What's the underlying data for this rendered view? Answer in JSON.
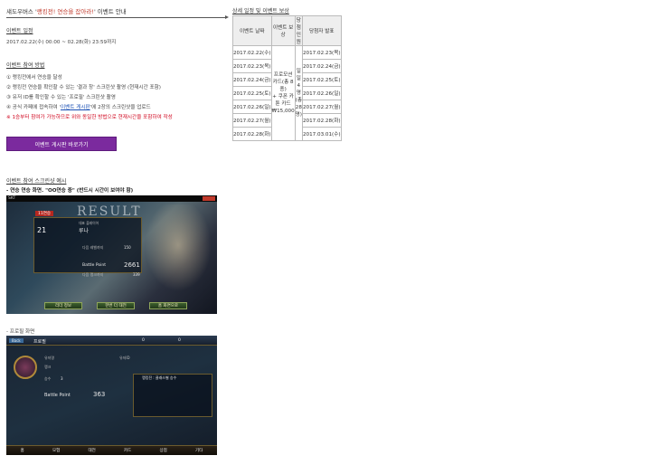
{
  "header": {
    "title_prefix": "섀도우버스 '",
    "title_highlight": "랭킹전! 연승을 잡아라!",
    "title_suffix": "' 이벤트 안내"
  },
  "schedule": {
    "heading": "이벤트 일정",
    "period": "2017.02.22(수) 00:00 ~ 02.28(화) 23:59까지"
  },
  "method": {
    "heading": "이벤트 참여 방법",
    "steps": [
      "① 랭킹전에서 연승을 달성",
      "② 랭킹전 연승을 확인할 수 있는 '결과 창' 스크린샷 촬영 (현재시간 포함)",
      "③ 유저 ID를 확인할 수 있는 '프로필' 스크린샷 촬영"
    ],
    "step4_prefix": "④ 공식 카페에 접속하여 '",
    "step4_link": "이벤트 게시판",
    "step4_suffix": "'에 2장의 스크린샷을 업로드",
    "warning": "※ 1승부터 참여가 가능하므로 위와 동일한 방법으로 현재시간을 포함하여 작성"
  },
  "cta": {
    "label": "이벤트 게시판 바로가기"
  },
  "examples": {
    "heading": "이벤트 참여 스크린샷 예시",
    "example1_caption": "- 연승 연승 화면. \"OO연승 중\" (반드시 시간이 보여야 함)",
    "example2_caption": "- 프로필 화면"
  },
  "game1": {
    "carrier": "SKT",
    "banner": "RESULT",
    "wins_badge": "11연승",
    "rank_num": "21",
    "rank_label": "대표 플레이어",
    "player": "루나",
    "next_label": "다음 레벨까지",
    "next_value": "150",
    "bp_label": "Battle Point",
    "bp_value": "2661",
    "next2_label": "다음 랭크까지",
    "next2_value": "339",
    "btn_1": "리더 정보",
    "btn_2": "한번 더 대전",
    "btn_3": "홈 화면으로"
  },
  "game2": {
    "back": "Back",
    "title": "프로필",
    "level_label": "유저명",
    "rank_label": "랭크",
    "win_label": "승수",
    "win_value": "3",
    "bp_label": "Battle Point",
    "bp_value": "363",
    "id_label": "유저ID",
    "ranking_label": "랭킹전 : 클래스별 승수",
    "counter_1": "0",
    "counter_2": "0",
    "nav": [
      "홈",
      "모험",
      "대전",
      "카드",
      "상점",
      "기타"
    ]
  },
  "table": {
    "heading": "상세 일정 및 이벤트 보상",
    "columns": [
      "이벤트 날짜",
      "이벤트 보상",
      "당첨 인원",
      "당첨자 발표"
    ],
    "dates": [
      "2017.02.22(수)",
      "2017.02.23(목)",
      "2017.02.24(금)",
      "2017.02.25(토)",
      "2017.02.26(일)",
      "2017.02.27(월)",
      "2017.02.28(화)"
    ],
    "reward_line1": "프로모션 카드(총 8종)",
    "reward_line2": "+ 쿠폰 카툰 카드",
    "reward_line3": "₩15,000",
    "winners_line1": "일일 4명",
    "winners_line2": "(총 28명)",
    "announce": [
      "2017.02.23(목)",
      "2017.02.24(금)",
      "2017.02.25(토)",
      "2017.02.26(일)",
      "2017.02.27(월)",
      "2017.02.28(화)",
      "2017.03.01(수)"
    ]
  }
}
